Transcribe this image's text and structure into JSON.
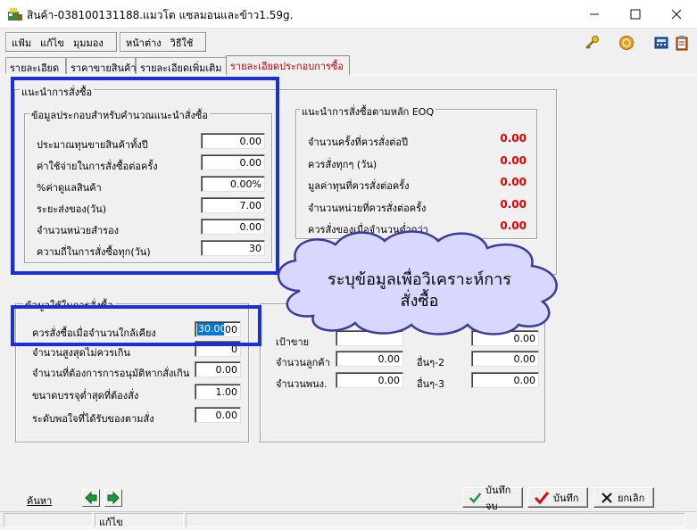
{
  "window": {
    "title": "สินค้า-038100131188.แมวโต แซลมอนและข้าว1.59g.",
    "controls": [
      "minimize",
      "maximize",
      "close"
    ]
  },
  "menu": {
    "group1": [
      "แฟ้ม",
      "แก้ไข",
      "มุมมอง"
    ],
    "group2": [
      "หน้าต่าง",
      "วิธีใช้"
    ],
    "toolbar_icons": [
      "key-icon",
      "gold-coin-icon",
      "calculator-icon",
      "clipboard-icon"
    ]
  },
  "tabs": [
    {
      "label": "รายละเอียด",
      "active": false
    },
    {
      "label": "ราคาขายสินค้า",
      "active": false
    },
    {
      "label": "รายละเอียดเพิ่มเติม",
      "active": false
    },
    {
      "label": "รายละเอียดประกอบการซื้อ",
      "active": true
    }
  ],
  "purchase_advice": {
    "group_title": "แนะนำการสั่งซื้อ",
    "calc_group_title": "ข้อมูลประกอบสำหรับคำนวณแนะนำสั่งซื้อ",
    "fields": [
      {
        "label": "ประมาณทุนขายสินค้าทั้งปี",
        "value": "0.00"
      },
      {
        "label": "ค่าใช้จ่ายในการสั่งซื้อต่อครั้ง",
        "value": "0.00"
      },
      {
        "label": "%ค่าดูแลสินค้า",
        "value": "0.00%"
      },
      {
        "label": "ระยะส่งของ(วัน)",
        "value": "7.00"
      },
      {
        "label": "จำนวนหน่วยสำรอง",
        "value": "0.00"
      },
      {
        "label": "ความถี่ในการสั่งซื้อทุก(วัน)",
        "value": "30"
      }
    ]
  },
  "eoq": {
    "group_title": "แนะนำการสั่งซื้อตามหลัก EOQ",
    "rows": [
      {
        "label": "จำนวนครั้งที่ควรสั่งต่อปี",
        "value": "0.00"
      },
      {
        "label": "ควรสั่งทุกๆ (วัน)",
        "value": "0.00"
      },
      {
        "label": "มูลค่าทุนที่ควรสั่งต่อครั้ง",
        "value": "0.00"
      },
      {
        "label": "จำนวนหน่วยที่ควรสั่งต่อครั้ง",
        "value": "0.00"
      },
      {
        "label": "ควรสั่งของเมื่อจำนวนต่ำกว่า",
        "value": "0.00"
      }
    ]
  },
  "order_conditions": {
    "group_title": "ข้อมูลใช้ในการสั่งซื้อ",
    "fields": [
      {
        "label": "ควรสั่งซื้อเมื่อจำนวนใกล้เคียง",
        "value": "30.00",
        "selected": true
      },
      {
        "label": "จำนวนสูงสุดไม่ควรเกิน",
        "value": "0"
      },
      {
        "label": "จำนวนที่ต้องการการอนุมัติหากสั่งเกิน",
        "value": "0.00"
      },
      {
        "label": "ขนาดบรรจุต่ำสุดที่ต้องสั่ง",
        "value": "1.00"
      },
      {
        "label": "ระดับพอใจที่ได้รับของตามสั่ง",
        "value": "0.00"
      }
    ]
  },
  "other": {
    "rows": [
      {
        "left_label": "เป้าขาย",
        "left_value": "",
        "right_label": "",
        "right_value": "0.00"
      },
      {
        "left_label": "จำนวนลูกค้า",
        "left_value": "0.00",
        "right_label": "อื่นๆ-2",
        "right_value": "0.00"
      },
      {
        "left_label": "จำนวนพนง.",
        "left_value": "0.00",
        "right_label": "อื่นๆ-3",
        "right_value": "0.00"
      }
    ]
  },
  "callout": {
    "line1": "ระบุข้อมูลเพื่อวิเคราะห์การ",
    "line2": "สั่งซื้อ"
  },
  "bottom": {
    "search_link": "ค้นหา",
    "save_close": "บันทึกจบ",
    "save": "บันทึก",
    "cancel": "ยกเลิก"
  },
  "status": {
    "mode": "แก้ไข"
  },
  "colors": {
    "highlight_box": "#1a2fd6",
    "eoq_value": "#e00000",
    "active_tab": "#c00000"
  }
}
